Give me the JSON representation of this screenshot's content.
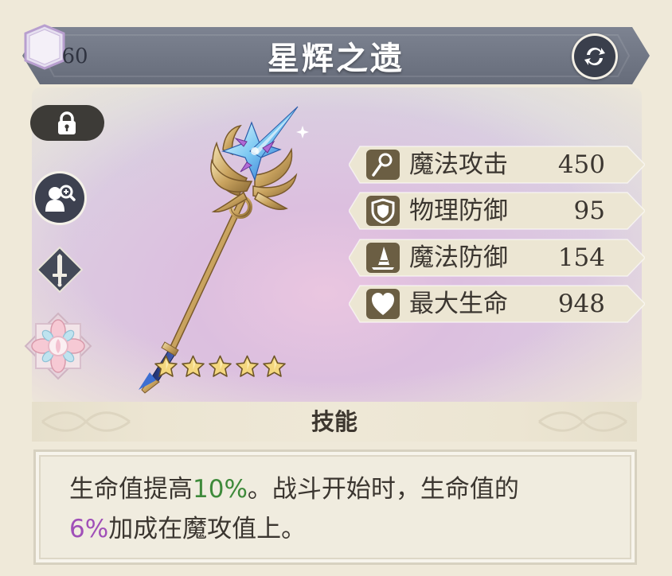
{
  "header": {
    "level": "60",
    "title": "星辉之遗"
  },
  "weapon": {
    "rarity_stars": 5
  },
  "stats": [
    {
      "icon": "wand-icon",
      "label": "魔法攻击",
      "value": "450"
    },
    {
      "icon": "shield-icon",
      "label": "物理防御",
      "value": "95"
    },
    {
      "icon": "wizard-hat-icon",
      "label": "魔法防御",
      "value": "154"
    },
    {
      "icon": "heart-icon",
      "label": "最大生命",
      "value": "948"
    }
  ],
  "skill": {
    "header": "技能",
    "desc_part1": "生命值提高",
    "desc_hl1": "10%",
    "desc_part2": "。战斗开始时，生命值的",
    "desc_hl2": "6%",
    "desc_part3": "加成在魔攻值上。"
  },
  "colors": {
    "banner": "#6f7584",
    "highlight_green": "#3e8a3a",
    "highlight_purple": "#a04fb8",
    "stat_icon_bg": "#6b5e43"
  }
}
